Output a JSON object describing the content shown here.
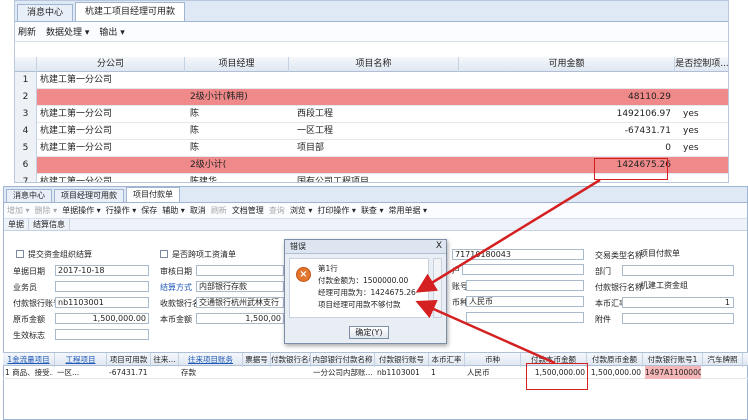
{
  "top": {
    "tabs": [
      "消息中心",
      "杭建工项目经理可用款"
    ],
    "toolbar": [
      "刷新",
      "数据处理 ▾",
      "输出 ▾"
    ],
    "columns": [
      "分公司",
      "项目经理",
      "项目名称",
      "可用金额",
      "是否控制项..."
    ],
    "rows": [
      {
        "n": "1",
        "company": "杭建工第一分公司",
        "manager": "",
        "project": "",
        "amount": "",
        "ctrl": "",
        "red": false
      },
      {
        "n": "2",
        "company": "",
        "manager": "2级小计(韩用)",
        "project": "",
        "amount": "48110.29",
        "ctrl": "",
        "red": true
      },
      {
        "n": "3",
        "company": "杭建工第一分公司",
        "manager": "陈",
        "project": "西段工程",
        "amount": "1492106.97",
        "ctrl": "yes",
        "red": false
      },
      {
        "n": "4",
        "company": "杭建工第一分公司",
        "manager": "陈",
        "project": "一区工程",
        "amount": "-67431.71",
        "ctrl": "yes",
        "red": false
      },
      {
        "n": "5",
        "company": "杭建工第一分公司",
        "manager": "陈",
        "project": "项目部",
        "amount": "0",
        "ctrl": "yes",
        "red": false
      },
      {
        "n": "6",
        "company": "",
        "manager": "2级小计(",
        "project": "",
        "amount": "1424675.26",
        "ctrl": "",
        "red": true
      },
      {
        "n": "7",
        "company": "杭建工第一分公司",
        "manager": "陈建华",
        "project": "国有公司工程项目",
        "amount": "",
        "ctrl": "",
        "red": false
      }
    ]
  },
  "bot": {
    "tabs": [
      "消息中心",
      "项目经理可用款",
      "项目付款单"
    ],
    "toolbar": [
      [
        "增加 ▾",
        true
      ],
      [
        "删除 ▾",
        true
      ],
      [
        "单据操作 ▾",
        false
      ],
      [
        "行操作 ▾",
        false
      ],
      [
        "保存",
        false
      ],
      [
        "辅助 ▾",
        false
      ],
      [
        "取消",
        false
      ],
      [
        "刷新",
        true
      ],
      [
        "文档管理",
        false
      ],
      [
        "查询",
        true
      ],
      [
        "浏览 ▾",
        false
      ],
      [
        "打印操作 ▾",
        false
      ],
      [
        "联查 ▾",
        false
      ],
      [
        "常用单据 ▾",
        false
      ]
    ],
    "subtabs": [
      "单据",
      "结算信息"
    ],
    "form": {
      "chk_settle": "提交资金组织结算",
      "chk_project": "是否跨项工资清单",
      "bill_date_label": "单据日期",
      "bill_date": "2017-10-18",
      "sign_date_label": "审核日期",
      "settle_label": "结算方式",
      "settle": "内部银行存款",
      "salesman_label": "业务员",
      "bank_label": "收款银行名称",
      "bank": "交通银行杭州武林支行",
      "acct_label": "付款银行账号",
      "acct": "nb1103001",
      "orig_label": "原币金额",
      "orig": "1,500,000.00",
      "local_label": "本币金额",
      "local": "1,500,00",
      "flag_label": "生效标志",
      "code": "71710180043",
      "lbl_a": "户",
      "lbl_b": "账号",
      "lbl_c": "币种",
      "lbl_d": "",
      "currency": "人民币",
      "rtype_label": "交易类型名称",
      "rtype": "项目付款单",
      "dept_label": "部门",
      "org_label": "付款银行名称",
      "org": "机建工资金组",
      "rate_label": "本币汇率",
      "rate": "1",
      "attach_label": "附件"
    },
    "grid_cols": [
      "1金流量项目",
      "工程项目",
      "项目可用款",
      "往来...",
      "往来项目账务",
      "票据号",
      "付款银行名称",
      "内部银行付款名称",
      "付款银行账号",
      "本币汇率",
      "币种",
      "付款本币金额",
      "付款原币金额",
      "付款银行账号1",
      "汽车牌照"
    ],
    "grid_row": [
      "1 商品、接受...",
      "一区...",
      "-67431.71",
      "",
      "存款",
      "",
      "",
      "一分公司内部账...",
      "nb1103001",
      "1",
      "人民币",
      "1,500,000.00",
      "1,500,000.00",
      "1497A1100000...",
      ""
    ]
  },
  "dialog": {
    "title": "错误",
    "close": "X",
    "lines": [
      "第1行",
      "付款金额为：1500000.00",
      "经理可用款为：1424675.26",
      "项目经理可用款不够付款"
    ],
    "ok": "确定(Y)"
  }
}
